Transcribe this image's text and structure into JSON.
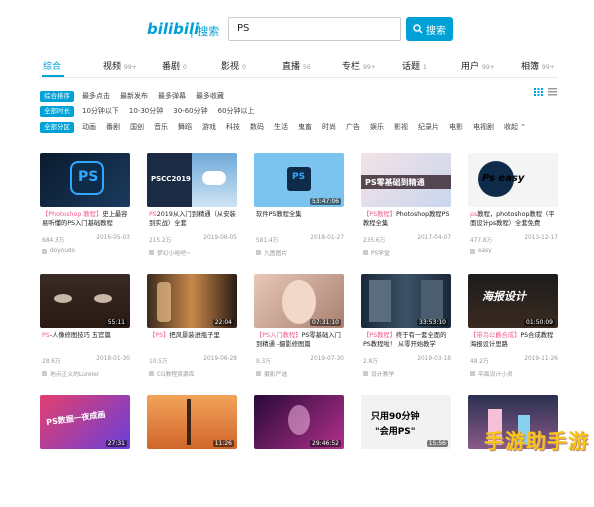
{
  "header": {
    "logo": "bilibili",
    "logo_sub": "| 搜索",
    "search_value": "PS",
    "search_button": "搜索"
  },
  "tabs": [
    {
      "label": "综合",
      "count": ""
    },
    {
      "label": "视频",
      "count": "99+"
    },
    {
      "label": "番剧",
      "count": "0"
    },
    {
      "label": "影视",
      "count": "0"
    },
    {
      "label": "直播",
      "count": "56"
    },
    {
      "label": "专栏",
      "count": "99+"
    },
    {
      "label": "话题",
      "count": "1"
    },
    {
      "label": "用户",
      "count": "99+"
    },
    {
      "label": "相簿",
      "count": "99+"
    }
  ],
  "filters": {
    "sort": {
      "chip": "综合排序",
      "options": [
        "最多点击",
        "最新发布",
        "最多弹幕",
        "最多收藏"
      ]
    },
    "duration": {
      "chip": "全部时长",
      "options": [
        "10分钟以下",
        "10-30分钟",
        "30-60分钟",
        "60分钟以上"
      ]
    },
    "zone": {
      "chip": "全部分区",
      "options": [
        "动画",
        "番剧",
        "国创",
        "音乐",
        "舞蹈",
        "游戏",
        "科技",
        "数码",
        "生活",
        "鬼畜",
        "时尚",
        "广告",
        "娱乐",
        "影视",
        "纪录片",
        "电影",
        "电视剧",
        "收起 ⌃"
      ]
    }
  },
  "cards": [
    {
      "hl": "【Photoshop 教程】",
      "rest": "史上最容易听懂的PS入门基础教程",
      "duration": "",
      "views": "684.3万",
      "date": "2016-05-03",
      "author": "doyoudo"
    },
    {
      "hl": "PS",
      "rest": "2019从入门到精通（从安装到实战）全套",
      "duration": "",
      "views": "215.2万",
      "date": "2019-06-05",
      "author": "梦幻小哈吧~"
    },
    {
      "hl": "",
      "rest": "软件PS教程全集",
      "duration": "53:47:06",
      "views": "581.4万",
      "date": "2018-01-27",
      "author": "九图图片"
    },
    {
      "hl": "【PS教程】",
      "rest": "Photoshop教程PS教程全集",
      "duration": "",
      "views": "235.6万",
      "date": "2017-04-07",
      "author": "PS学堂"
    },
    {
      "hl": "ps",
      "rest": "教程，photoshop教程（平面设计ps教程）全套免费",
      "duration": "",
      "views": "477.8万",
      "date": "2013-12-17",
      "author": "easy"
    },
    {
      "hl": "PS",
      "rest": "-人像修图技巧 五官篇",
      "duration": "55:11",
      "views": "28.6万",
      "date": "2018-01-30",
      "author": "地点正义的Lureler"
    },
    {
      "hl": "【PS】",
      "rest": "把风景装进瓶子里",
      "duration": "22:04",
      "views": "10.5万",
      "date": "2019-06-28",
      "author": "CG教程资源库"
    },
    {
      "hl": "【PS入门教程】",
      "rest": "PS零基础入门到精通 -摄影修图篇",
      "duration": "07:31:10",
      "views": "9.3万",
      "date": "2019-07-30",
      "author": "摄影严选"
    },
    {
      "hl": "【PS教程】",
      "rest": "终于有一套全面的PS教程啦！ 从零开始教学",
      "duration": "33:53:10",
      "views": "2.8万",
      "date": "2019-03-18",
      "author": "设计教学"
    },
    {
      "hl": "【带鸟公爵合成】",
      "rest": "PS合成教程 海报设计思路",
      "duration": "01:50:09",
      "views": "48.2万",
      "date": "2019-11-26",
      "author": "平面设计小灵"
    },
    {
      "hl": "",
      "rest": "",
      "duration": "27:31",
      "views": "",
      "date": "",
      "author": ""
    },
    {
      "hl": "",
      "rest": "",
      "duration": "11:26",
      "views": "",
      "date": "",
      "author": ""
    },
    {
      "hl": "",
      "rest": "",
      "duration": "29:46:52",
      "views": "",
      "date": "",
      "author": ""
    },
    {
      "hl": "",
      "rest": "",
      "duration": "15:56",
      "views": "",
      "date": "",
      "author": ""
    },
    {
      "hl": "",
      "rest": "",
      "duration": "",
      "views": "",
      "date": "",
      "author": ""
    }
  ],
  "thumb_text": {
    "t1": "PS",
    "t2": "PSCC2019",
    "t3": "PS",
    "t4": "PS零基础到精通",
    "t5": "Ps easy",
    "t10": "海报设计",
    "t11": "PS数据一夜成画",
    "t14a": "只用90分钟",
    "t14b": "\"会用PS\""
  },
  "watermark": "手游助手游",
  "colors": {
    "accent": "#00a1d6",
    "highlight": "#f25d8e"
  }
}
